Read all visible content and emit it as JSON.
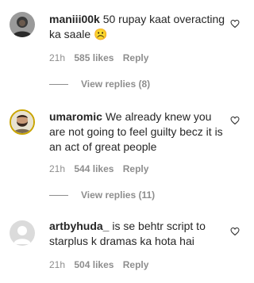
{
  "comments": [
    {
      "username": "maniii00k",
      "text": "50 rupay kaat overacting ka saale ☹️",
      "time": "21h",
      "likes": "585 likes",
      "reply": "Reply",
      "view_replies": "View replies (8)",
      "avatar": "avatar-dark-hoodie",
      "icon": "heart-icon"
    },
    {
      "username": "umaromic",
      "text": "We already knew you are not going to feel guilty becz it is an act of great people",
      "time": "21h",
      "likes": "544 likes",
      "reply": "Reply",
      "view_replies": "View replies (11)",
      "avatar": "avatar-bearded-man",
      "icon": "heart-icon"
    },
    {
      "username": "artbyhuda_",
      "text": "is se behtr script to starplus k dramas ka hota hai",
      "time": "21h",
      "likes": "504 likes",
      "reply": "Reply",
      "avatar": "avatar-default",
      "icon": "heart-icon"
    }
  ],
  "colors": {
    "primary_text": "#262626",
    "secondary_text": "#8e8e8e",
    "background": "#ffffff",
    "avatar_ring": "#c9a400"
  }
}
